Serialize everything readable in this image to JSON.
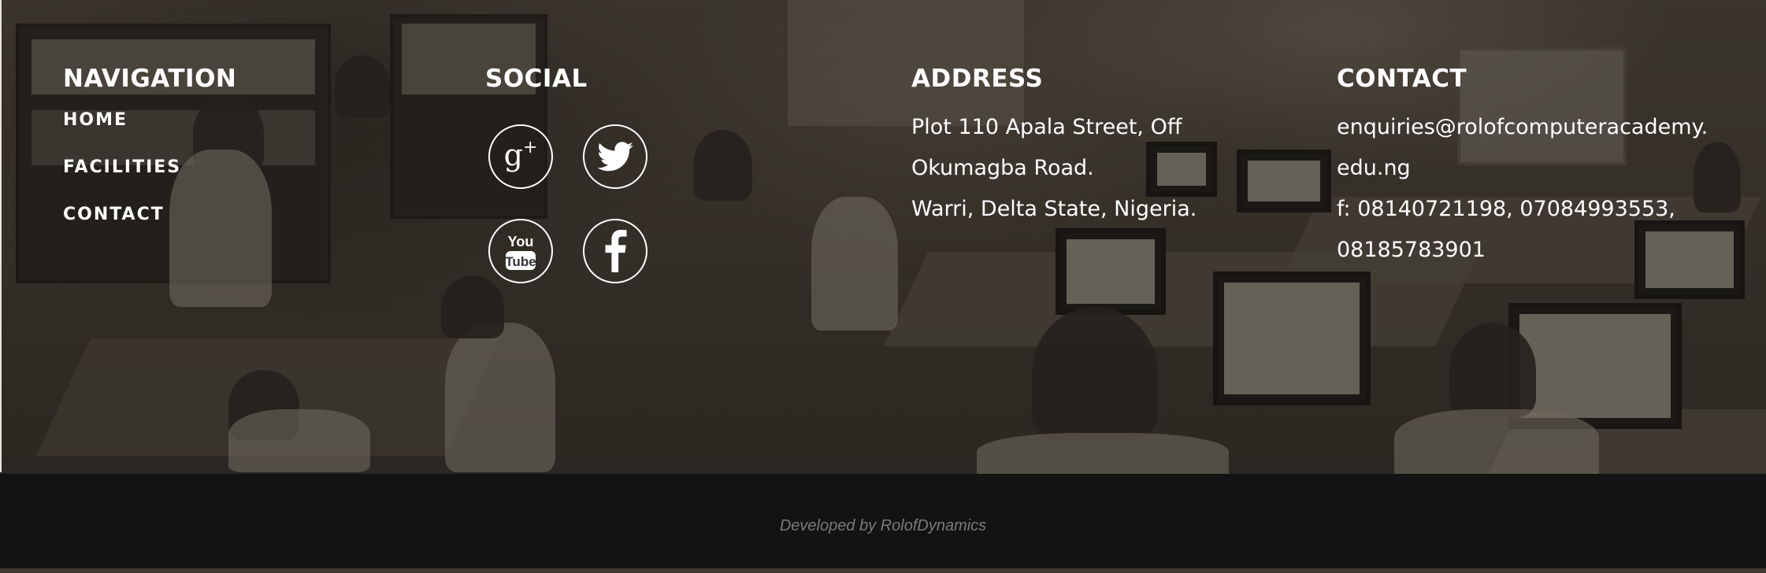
{
  "navigation": {
    "heading": "NAVIGATION",
    "items": [
      {
        "label": "HOME"
      },
      {
        "label": "FACILITIES"
      },
      {
        "label": "CONTACT"
      }
    ]
  },
  "social": {
    "heading": "SOCIAL",
    "icons": [
      {
        "name": "google-plus-icon",
        "glyph": "g",
        "sup": "+"
      },
      {
        "name": "twitter-icon"
      },
      {
        "name": "youtube-icon",
        "line1": "You",
        "line2": "Tube"
      },
      {
        "name": "facebook-icon",
        "glyph": "f"
      }
    ]
  },
  "address": {
    "heading": "ADDRESS",
    "lines": [
      "Plot 110 Apala Street, Off",
      "Okumagba Road.",
      "Warri, Delta State, Nigeria."
    ]
  },
  "contact": {
    "heading": "CONTACT",
    "lines": [
      "enquiries@rolofcomputeracademy.",
      "edu.ng",
      "f: 08140721198, 07084993553,",
      "08185783901"
    ]
  },
  "footer": {
    "credit": "Developed by RolofDynamics"
  },
  "colors": {
    "footer_bar": "#131313",
    "text": "#ffffff",
    "credit_text": "#7a7a7a"
  }
}
